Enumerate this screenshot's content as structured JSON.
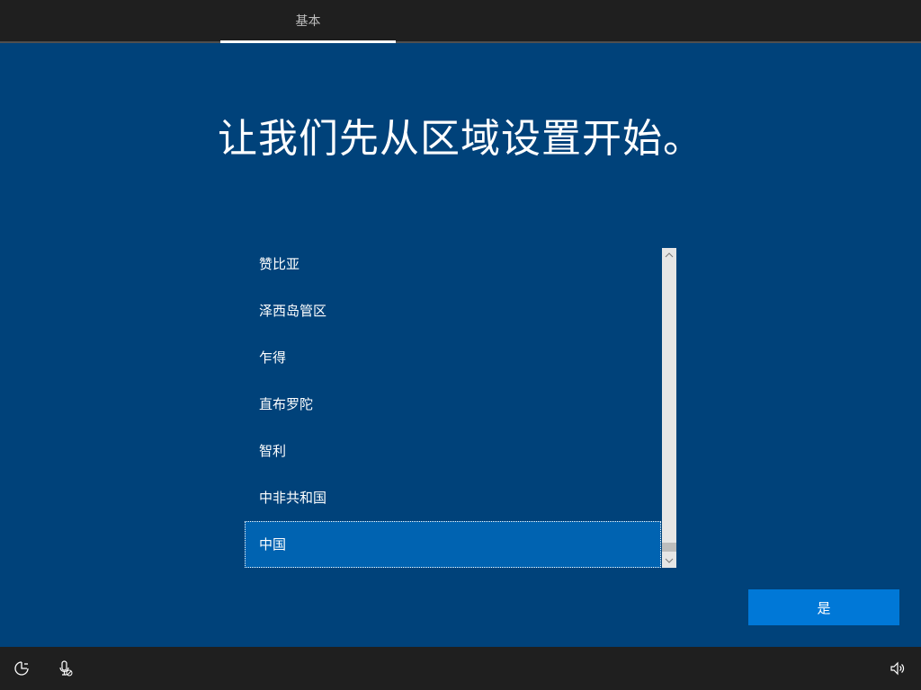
{
  "header": {
    "tab_label": "基本"
  },
  "main": {
    "title": "让我们先从区域设置开始。",
    "region_list": [
      {
        "label": "赞比亚",
        "selected": false
      },
      {
        "label": "泽西岛管区",
        "selected": false
      },
      {
        "label": "乍得",
        "selected": false
      },
      {
        "label": "直布罗陀",
        "selected": false
      },
      {
        "label": "智利",
        "selected": false
      },
      {
        "label": "中非共和国",
        "selected": false
      },
      {
        "label": "中国",
        "selected": true
      }
    ],
    "yes_button": "是"
  },
  "footer": {
    "icons": [
      "ease-of-access-icon",
      "microphone-icon",
      "volume-icon"
    ]
  },
  "colors": {
    "background": "#00427a",
    "topbar": "#1f1f1f",
    "selected_item": "#0063b1",
    "primary_button": "#0078d7"
  }
}
